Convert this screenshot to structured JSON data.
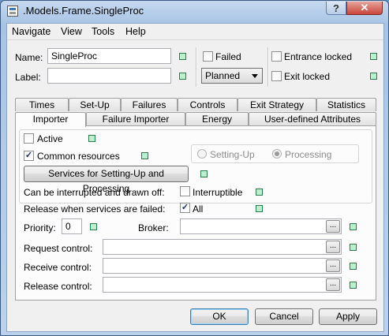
{
  "window": {
    "title": ".Models.Frame.SingleProc"
  },
  "menu": [
    "Navigate",
    "View",
    "Tools",
    "Help"
  ],
  "header": {
    "name_label": "Name:",
    "name_value": "SingleProc",
    "label_label": "Label:",
    "label_value": "",
    "failed_label": "Failed",
    "failed_checked": false,
    "status_value": "Planned",
    "entrance_locked_label": "Entrance locked",
    "entrance_locked_checked": false,
    "exit_locked_label": "Exit locked",
    "exit_locked_checked": false
  },
  "tabs_row1": [
    "Times",
    "Set-Up",
    "Failures",
    "Controls",
    "Exit Strategy",
    "Statistics"
  ],
  "tabs_row2": [
    "Importer",
    "Failure Importer",
    "Energy",
    "User-defined Attributes"
  ],
  "active_tab": "Importer",
  "importer": {
    "active_label": "Active",
    "active_checked": false,
    "common_resources_label": "Common resources",
    "common_resources_checked": true,
    "setting_up_label": "Setting-Up",
    "processing_label": "Processing",
    "services_button": "Services for Setting-Up and Processing",
    "interrupt_label": "Can be interrupted and drawn off:",
    "interruptible_label": "Interruptible",
    "interruptible_checked": false,
    "release_failed_label": "Release when services are failed:",
    "all_label": "All",
    "all_checked": true,
    "priority_label": "Priority:",
    "priority_value": "0",
    "broker_label": "Broker:",
    "broker_value": "",
    "request_control_label": "Request control:",
    "receive_control_label": "Receive control:",
    "release_control_label": "Release control:",
    "ellipsis": "..."
  },
  "footer": {
    "ok": "OK",
    "cancel": "Cancel",
    "apply": "Apply"
  },
  "glyphs": {
    "help": "?",
    "close": "✕",
    "check": "✓"
  }
}
